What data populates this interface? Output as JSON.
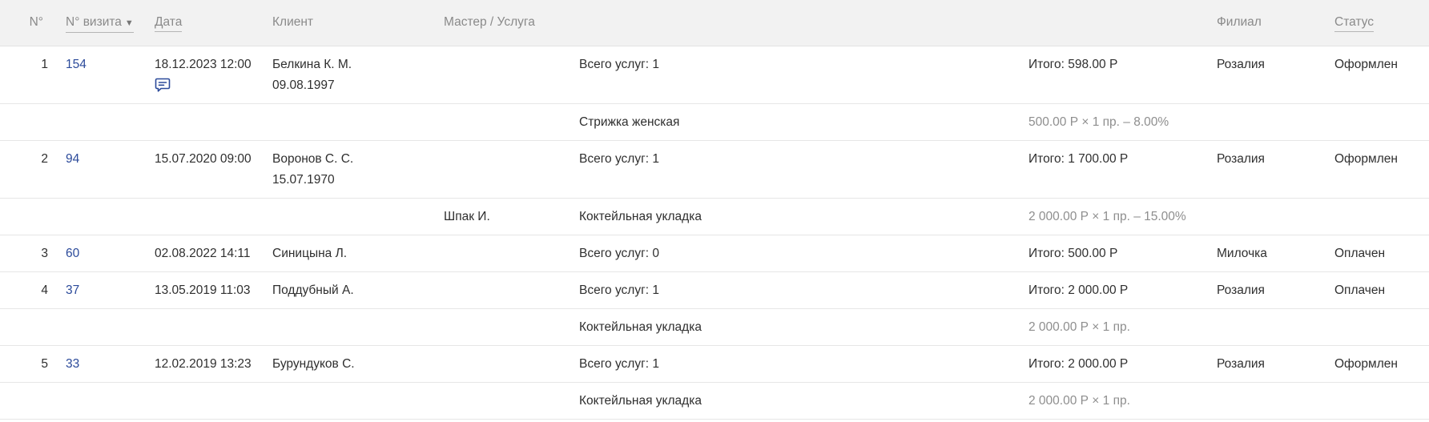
{
  "header": {
    "num": "N°",
    "visit": "N° визита",
    "sort_arrow": "▼",
    "date": "Дата",
    "client": "Клиент",
    "master": "Мастер / Услуга",
    "branch": "Филиал",
    "status": "Статус"
  },
  "colors": {
    "link": "#2b4a9a",
    "header_bg": "#f2f2f2",
    "muted_text": "#8e8e8e"
  },
  "rows": [
    {
      "num": "1",
      "visit": "154",
      "date": "18.12.2023 12:00",
      "client_name": "Белкина К. М.",
      "client_birth": "09.08.1997",
      "services_total": "Всего услуг: 1",
      "total": "Итого: 598.00 Р",
      "branch": "Розалия",
      "status": "Оформлен",
      "has_comment_icon": "comment-icon",
      "services": [
        {
          "master": "",
          "name": "Стрижка женская",
          "price": "500.00 Р × 1 пр. – 8.00%"
        }
      ]
    },
    {
      "num": "2",
      "visit": "94",
      "date": "15.07.2020 09:00",
      "client_name": "Воронов С. С.",
      "client_birth": "15.07.1970",
      "services_total": "Всего услуг: 1",
      "total": "Итого: 1 700.00 Р",
      "branch": "Розалия",
      "status": "Оформлен",
      "services": [
        {
          "master": "Шпак И.",
          "name": "Коктейльная укладка",
          "price": "2 000.00 Р × 1 пр. – 15.00%"
        }
      ]
    },
    {
      "num": "3",
      "visit": "60",
      "date": "02.08.2022 14:11",
      "client_name": "Синицына Л.",
      "services_total": "Всего услуг: 0",
      "total": "Итого: 500.00 Р",
      "branch": "Милочка",
      "status": "Оплачен",
      "services": []
    },
    {
      "num": "4",
      "visit": "37",
      "date": "13.05.2019 11:03",
      "client_name": "Поддубный А.",
      "services_total": "Всего услуг: 1",
      "total": "Итого: 2 000.00 Р",
      "branch": "Розалия",
      "status": "Оплачен",
      "services": [
        {
          "master": "",
          "name": "Коктейльная укладка",
          "price": "2 000.00 Р × 1 пр."
        }
      ]
    },
    {
      "num": "5",
      "visit": "33",
      "date": "12.02.2019 13:23",
      "client_name": "Бурундуков С.",
      "services_total": "Всего услуг: 1",
      "total": "Итого: 2 000.00 Р",
      "branch": "Розалия",
      "status": "Оформлен",
      "services": [
        {
          "master": "",
          "name": "Коктейльная укладка",
          "price": "2 000.00 Р × 1 пр."
        }
      ]
    }
  ]
}
